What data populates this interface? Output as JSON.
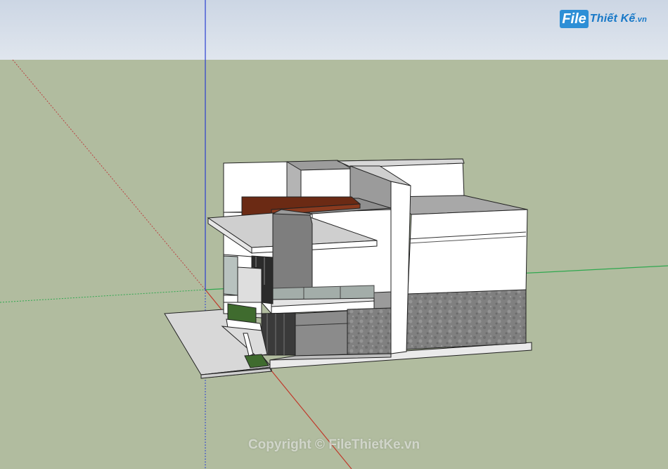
{
  "brand": {
    "badge": "File",
    "name": "Thiết Kế",
    "tld": ".vn"
  },
  "watermark": "Copyright © FileThietKe.vn",
  "colors": {
    "sky": "#d8dfea",
    "ground": "#b1bc9f",
    "axis_red": "#c0392b",
    "axis_green": "#2fa84f",
    "axis_blue": "#2a3fd0",
    "wall_white": "#ffffff",
    "wall_grey": "#8a8a8a",
    "roof_grey": "#9a9a9a",
    "stone": "#7e7e7e",
    "wood": "#6b2a14",
    "glass": "#9aa39f"
  }
}
